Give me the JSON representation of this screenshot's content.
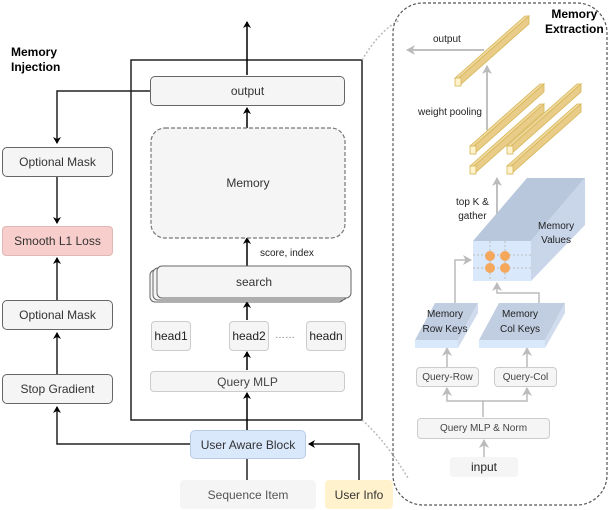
{
  "titles": {
    "injection": [
      "Memory",
      "Injection"
    ],
    "extraction": [
      "Memory",
      "Extraction"
    ]
  },
  "left_column": {
    "optional_mask_top": "Optional Mask",
    "smooth_l1_loss": "Smooth L1 Loss",
    "optional_mask_bottom": "Optional Mask",
    "stop_gradient": "Stop Gradient"
  },
  "center_block": {
    "output": "output",
    "memory": "Memory",
    "score_index": "score, index",
    "search": "search",
    "heads": [
      "head1",
      "head2",
      "headn"
    ],
    "ellipsis": "……",
    "query_mlp": "Query MLP"
  },
  "bottom": {
    "user_aware_block": "User Aware Block",
    "sequence_item": "Sequence Item",
    "user_info": "User Info"
  },
  "extraction": {
    "output": "output",
    "weight_pooling": "weight pooling",
    "top_k_gather": [
      "top K &",
      "gather"
    ],
    "memory_values": [
      "Memory",
      "Values"
    ],
    "row_keys": [
      "Memory",
      "Row Keys"
    ],
    "col_keys": [
      "Memory",
      "Col Keys"
    ],
    "query_row": "Query-Row",
    "query_col": "Query-Col",
    "query_mlp_norm": "Query MLP & Norm",
    "input": "input"
  },
  "colors": {
    "loss_fill": "#f8cecc",
    "user_aware_fill": "#dae8fc",
    "user_info_fill": "#fff2cc",
    "bar_fill": "#f5deb3",
    "bar_stroke": "#d6b656",
    "memory_block_front": "#dae8fc",
    "memory_block_side": "#c5d3e8",
    "memory_block_top": "#b8c7dc",
    "memory_dot": "#f5a85c"
  }
}
